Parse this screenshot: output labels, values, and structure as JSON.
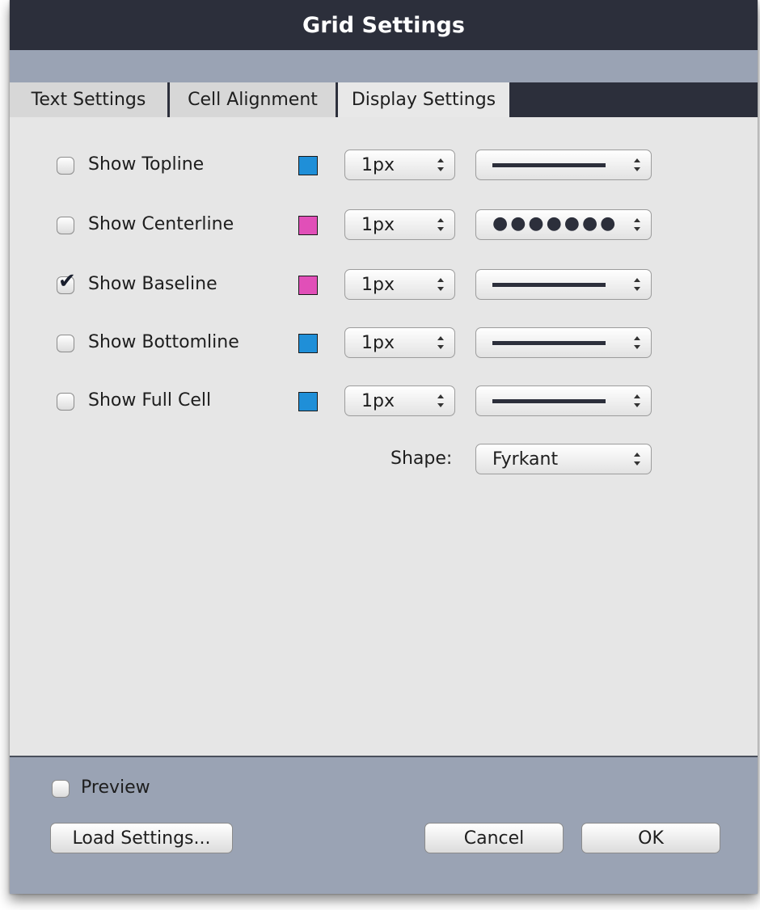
{
  "window": {
    "title": "Grid Settings"
  },
  "tabs": [
    {
      "label": "Text Settings"
    },
    {
      "label": "Cell Alignment"
    },
    {
      "label": "Display Settings"
    }
  ],
  "display": {
    "rows": [
      {
        "label": "Show Topline",
        "checked": false,
        "color": "#1f8fd8",
        "size": "1px",
        "style": "solid"
      },
      {
        "label": "Show Centerline",
        "checked": false,
        "color": "#e14fb8",
        "size": "1px",
        "style": "dotted"
      },
      {
        "label": "Show Baseline",
        "checked": true,
        "color": "#e14fb8",
        "size": "1px",
        "style": "solid"
      },
      {
        "label": "Show Bottomline",
        "checked": false,
        "color": "#1f8fd8",
        "size": "1px",
        "style": "solid"
      },
      {
        "label": "Show Full Cell",
        "checked": false,
        "color": "#1f8fd8",
        "size": "1px",
        "style": "solid"
      }
    ],
    "dot_pattern": "●●●●●●●",
    "shape": {
      "label": "Shape:",
      "value": "Fyrkant"
    }
  },
  "footer": {
    "preview_label": "Preview",
    "preview_checked": false,
    "load_label": "Load Settings...",
    "cancel_label": "Cancel",
    "ok_label": "OK"
  },
  "icons": {
    "select_arrows": "updown-arrows-icon",
    "checkmark": "checkmark-icon"
  }
}
